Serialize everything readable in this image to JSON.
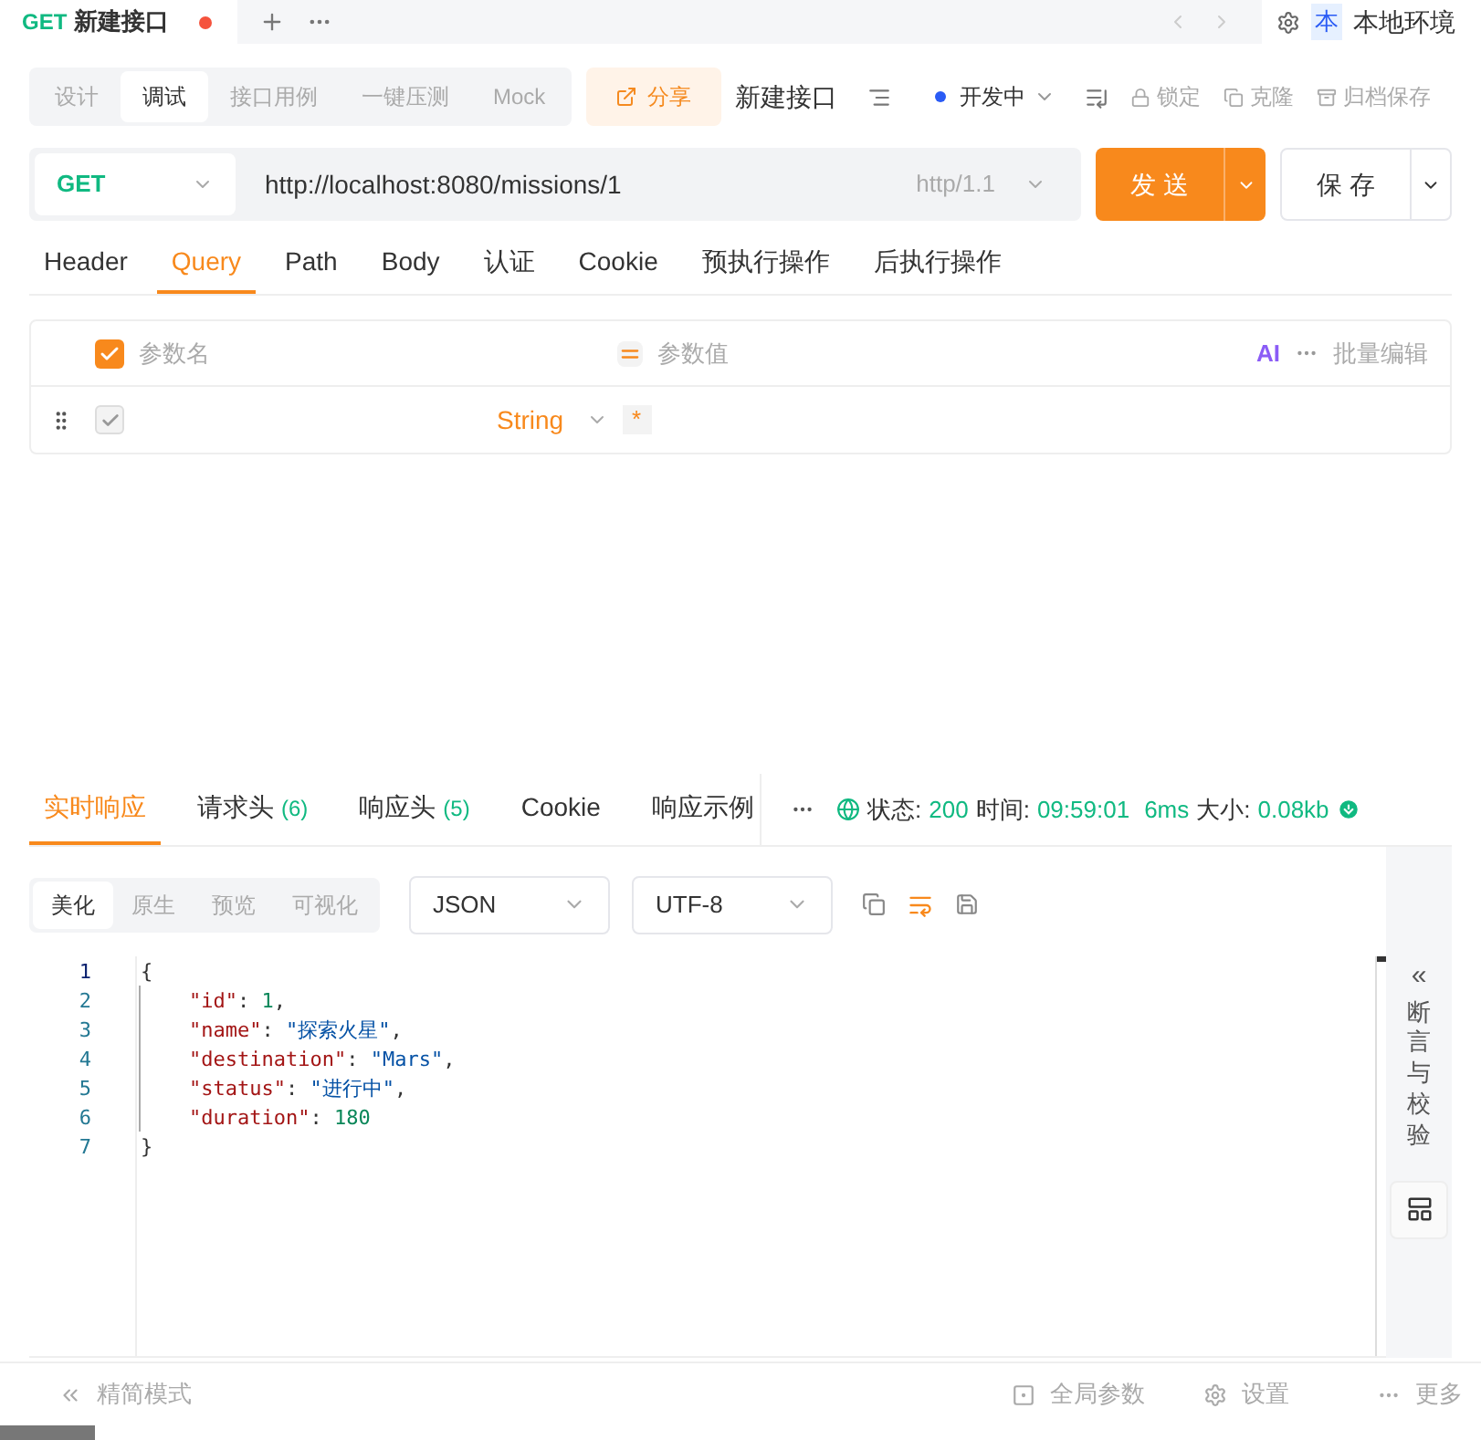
{
  "doc_tab": {
    "method": "GET",
    "title": "新建接口",
    "unsaved": true
  },
  "top_bar": {
    "env_badge": "本",
    "env": "本地环境"
  },
  "mode_tabs": [
    {
      "label": "设计",
      "selected": false
    },
    {
      "label": "调试",
      "selected": true
    },
    {
      "label": "接口用例",
      "selected": false
    },
    {
      "label": "一键压测",
      "selected": false
    },
    {
      "label": "Mock",
      "selected": false
    }
  ],
  "share": "分享",
  "api_name": "新建接口",
  "status": {
    "label": "开发中",
    "color": "#2a5bf5"
  },
  "actions": [
    {
      "kind": "lock",
      "label": "锁定"
    },
    {
      "kind": "clone",
      "label": "克隆"
    },
    {
      "kind": "archive",
      "label": "归档保存"
    }
  ],
  "request": {
    "method": "GET",
    "url": "http://localhost:8080/missions/1",
    "protocol": "http/1.1",
    "send": "发 送",
    "save": "保 存"
  },
  "request_tabs": [
    {
      "label": "Header",
      "selected": false
    },
    {
      "label": "Query",
      "selected": true
    },
    {
      "label": "Path",
      "selected": false
    },
    {
      "label": "Body",
      "selected": false
    },
    {
      "label": "认证",
      "selected": false
    },
    {
      "label": "Cookie",
      "selected": false
    },
    {
      "label": "预执行操作",
      "selected": false
    },
    {
      "label": "后执行操作",
      "selected": false
    }
  ],
  "params": {
    "all_checked": true,
    "name_header": "参数名",
    "value_header": "参数值",
    "ai": "AI",
    "batch_edit": "批量编辑",
    "rows": [
      {
        "checked": true,
        "type": "String",
        "required": "*"
      }
    ]
  },
  "response_tabs": [
    {
      "label": "实时响应",
      "selected": true
    },
    {
      "label": "请求头",
      "count": "(6)",
      "selected": false
    },
    {
      "label": "响应头",
      "count": "(5)",
      "selected": false
    },
    {
      "label": "Cookie",
      "selected": false
    },
    {
      "label": "响应示例",
      "selected": false
    }
  ],
  "response_status": {
    "status_label": "状态:",
    "status": "200",
    "time_label": "时间:",
    "time": "09:59:01",
    "duration": "6ms",
    "size_label": "大小:",
    "size": "0.08kb"
  },
  "format_tabs": [
    {
      "label": "美化",
      "selected": true
    },
    {
      "label": "原生",
      "selected": false
    },
    {
      "label": "预览",
      "selected": false
    },
    {
      "label": "可视化",
      "selected": false
    }
  ],
  "content_type": "JSON",
  "encoding": "UTF-8",
  "code": [
    [
      {
        "kind": "punct",
        "text": "{"
      }
    ],
    [
      {
        "kind": "key",
        "text": "    \"id\""
      },
      {
        "kind": "punct",
        "text": ": "
      },
      {
        "kind": "number",
        "text": "1"
      },
      {
        "kind": "punct",
        "text": ","
      }
    ],
    [
      {
        "kind": "key",
        "text": "    \"name\""
      },
      {
        "kind": "punct",
        "text": ": "
      },
      {
        "kind": "string",
        "text": "\"探索火星\""
      },
      {
        "kind": "punct",
        "text": ","
      }
    ],
    [
      {
        "kind": "key",
        "text": "    \"destination\""
      },
      {
        "kind": "punct",
        "text": ": "
      },
      {
        "kind": "string",
        "text": "\"Mars\""
      },
      {
        "kind": "punct",
        "text": ","
      }
    ],
    [
      {
        "kind": "key",
        "text": "    \"status\""
      },
      {
        "kind": "punct",
        "text": ": "
      },
      {
        "kind": "string",
        "text": "\"进行中\""
      },
      {
        "kind": "punct",
        "text": ","
      }
    ],
    [
      {
        "kind": "key",
        "text": "    \"duration\""
      },
      {
        "kind": "punct",
        "text": ": "
      },
      {
        "kind": "number",
        "text": "180"
      }
    ],
    [
      {
        "kind": "punct",
        "text": "}"
      }
    ]
  ],
  "line_numbers": [
    "1",
    "2",
    "3",
    "4",
    "5",
    "6",
    "7"
  ],
  "side_panel": {
    "chevron": "«",
    "label": "断言与校验"
  },
  "footer": {
    "compact": "精简模式",
    "global_params": "全局参数",
    "settings": "设置",
    "more": "更多"
  }
}
